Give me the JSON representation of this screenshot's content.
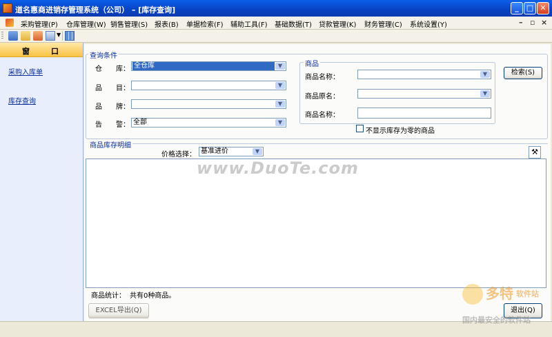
{
  "window": {
    "title": "道名惠商进销存管理系统（公司） – [库存查询]"
  },
  "menu": {
    "items": [
      "采购管理(P)",
      "仓库管理(W)",
      "销售管理(S)",
      "报表(B)",
      "单据检索(F)",
      "辅助工具(F)",
      "基础数据(T)",
      "贷款管理(K)",
      "财务管理(C)",
      "系统设置(Y)"
    ]
  },
  "sidebar": {
    "header_left": "窗",
    "header_right": "口",
    "links": [
      "采购入库单",
      "库存查询"
    ]
  },
  "query": {
    "group_title": "查询条件",
    "warehouse_label": "仓　　库：",
    "warehouse_value": "全仓库",
    "category_label": "品　　目：",
    "category_value": "",
    "brand_label": "品　　牌：",
    "brand_value": "",
    "alert_label": "告　　警：",
    "alert_value": "全部",
    "goods_group_title": "商品",
    "goods_name_label": "商品名称：",
    "goods_orig_label": "商品原名：",
    "goods_name2_label": "商品名称：",
    "hide_zero_label": "不显示库存为零的商品",
    "search_button": "检索(S)"
  },
  "detail": {
    "group_title": "商品库存明细",
    "price_label": "价格选择：",
    "price_value": "基准进价"
  },
  "footer": {
    "stats_label": "商品统计：",
    "stats_value": "共有0种商品。",
    "excel_button": "EXCEL导出(Q)",
    "exit_button": "退出(Q)"
  },
  "watermarks": {
    "site": "www.DuoTe.com",
    "brand": "多特",
    "brand_sub": "软件站",
    "tagline": "国内最安全的软件站"
  }
}
